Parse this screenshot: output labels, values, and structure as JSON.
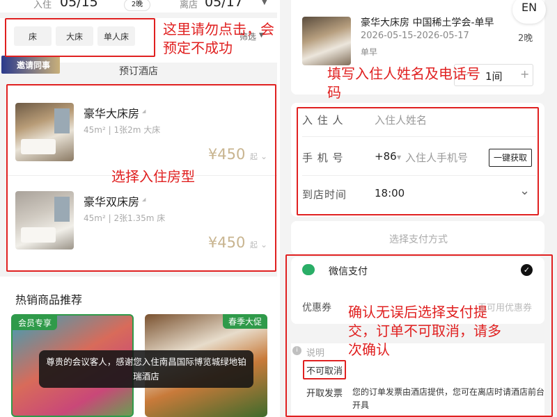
{
  "left": {
    "checkin_label": "入住",
    "checkin_date": "05/15",
    "nights": "2晚",
    "checkout_label": "离店",
    "checkout_date": "05/17",
    "filter_chips": [
      "床",
      "大床",
      "单人床"
    ],
    "filter_label": "筛选",
    "invite_banner": "邀请同事",
    "section_title": "预订酒店",
    "rooms": [
      {
        "name": "豪华大床房",
        "meta": "45m² | 1张2m 大床",
        "price": "¥450",
        "price_suffix": "起"
      },
      {
        "name": "豪华双床房",
        "meta": "45m² | 2张1.35m 床",
        "price": "¥450",
        "price_suffix": "起"
      }
    ],
    "hot_title": "热销商品推荐",
    "hot_tags": [
      "会员专享",
      "春季大促"
    ],
    "toast": "尊贵的会议客人，感谢您入住南昌国际博览城绿地铂瑞酒店"
  },
  "right": {
    "lang_button": "EN",
    "booking": {
      "room": "豪华大床房 中国稀土学会-单早",
      "dates": "2026-05-15-2026-05-17",
      "nights": "2晚",
      "breakfast": "单早",
      "room_count": "1间",
      "minus": "−",
      "plus": "+"
    },
    "form": {
      "guest_label": "入 住 人",
      "guest_placeholder": "入住人姓名",
      "phone_label": "手 机 号",
      "country_code": "+86",
      "phone_placeholder": "入住人手机号",
      "get_button": "一键获取",
      "arrival_label": "到店时间",
      "arrival_value": "18:00"
    },
    "payment_header": "选择支付方式",
    "payment_method": "微信支付",
    "coupon_label": "优惠券",
    "coupon_value": "无可用优惠券",
    "note_label": "说明",
    "non_cancel": "不可取消",
    "invoice_label": "开取发票",
    "invoice_text": "您的订单发票由酒店提供，您可在离店时请酒店前台开具"
  },
  "annotations": {
    "filter": "这里请勿点击，会预定不成功",
    "rooms": "选择入住房型",
    "form": "填写入住人姓名及电话号码",
    "payment": "确认无误后选择支付提交，订单不可取消，请多次确认"
  },
  "colors": {
    "annotation_red": "#e02020",
    "price_gold": "#c8b48f",
    "wechat_green": "#2aae67",
    "member_green": "#2f9a4a"
  }
}
